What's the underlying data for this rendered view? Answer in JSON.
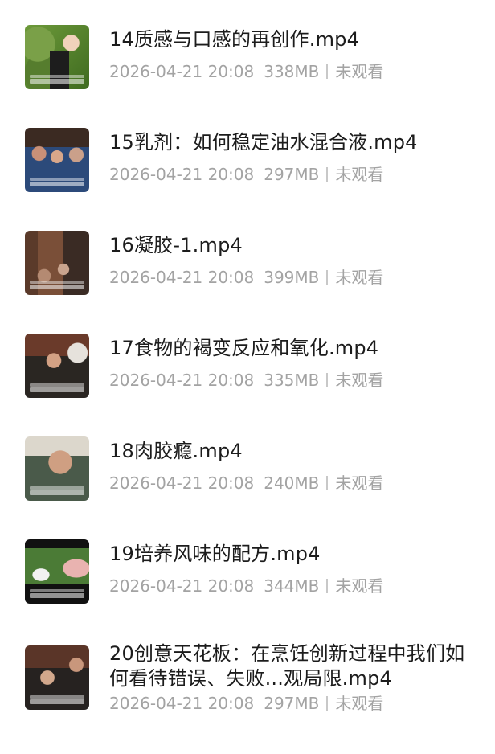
{
  "files": [
    {
      "title": "14质感与口感的再创作.mp4",
      "date": "2026-04-21 20:08",
      "size": "338MB",
      "status": "未观看",
      "thumbnail": "video-thumbnail-woman-garden"
    },
    {
      "title": "15乳剂：如何稳定油水混合液.mp4",
      "date": "2026-04-21 20:08",
      "size": "297MB",
      "status": "未观看",
      "thumbnail": "video-thumbnail-audience"
    },
    {
      "title": "16凝胶-1.mp4",
      "date": "2026-04-21 20:08",
      "size": "399MB",
      "status": "未观看",
      "thumbnail": "video-thumbnail-lecture-hall"
    },
    {
      "title": "17食物的褐变反应和氧化.mp4",
      "date": "2026-04-21 20:08",
      "size": "335MB",
      "status": "未观看",
      "thumbnail": "video-thumbnail-audience"
    },
    {
      "title": "18肉胶瘾.mp4",
      "date": "2026-04-21 20:08",
      "size": "240MB",
      "status": "未观看",
      "thumbnail": "video-thumbnail-man-glasses"
    },
    {
      "title": "19培养风味的配方.mp4",
      "date": "2026-04-21 20:08",
      "size": "344MB",
      "status": "未观看",
      "thumbnail": "video-thumbnail-farm-animals"
    },
    {
      "title": "20创意天花板：在烹饪创新过程中我们如何看待错误、失败...观局限.mp4",
      "date": "2026-04-21 20:08",
      "size": "297MB",
      "status": "未观看",
      "thumbnail": "video-thumbnail-audience"
    }
  ]
}
